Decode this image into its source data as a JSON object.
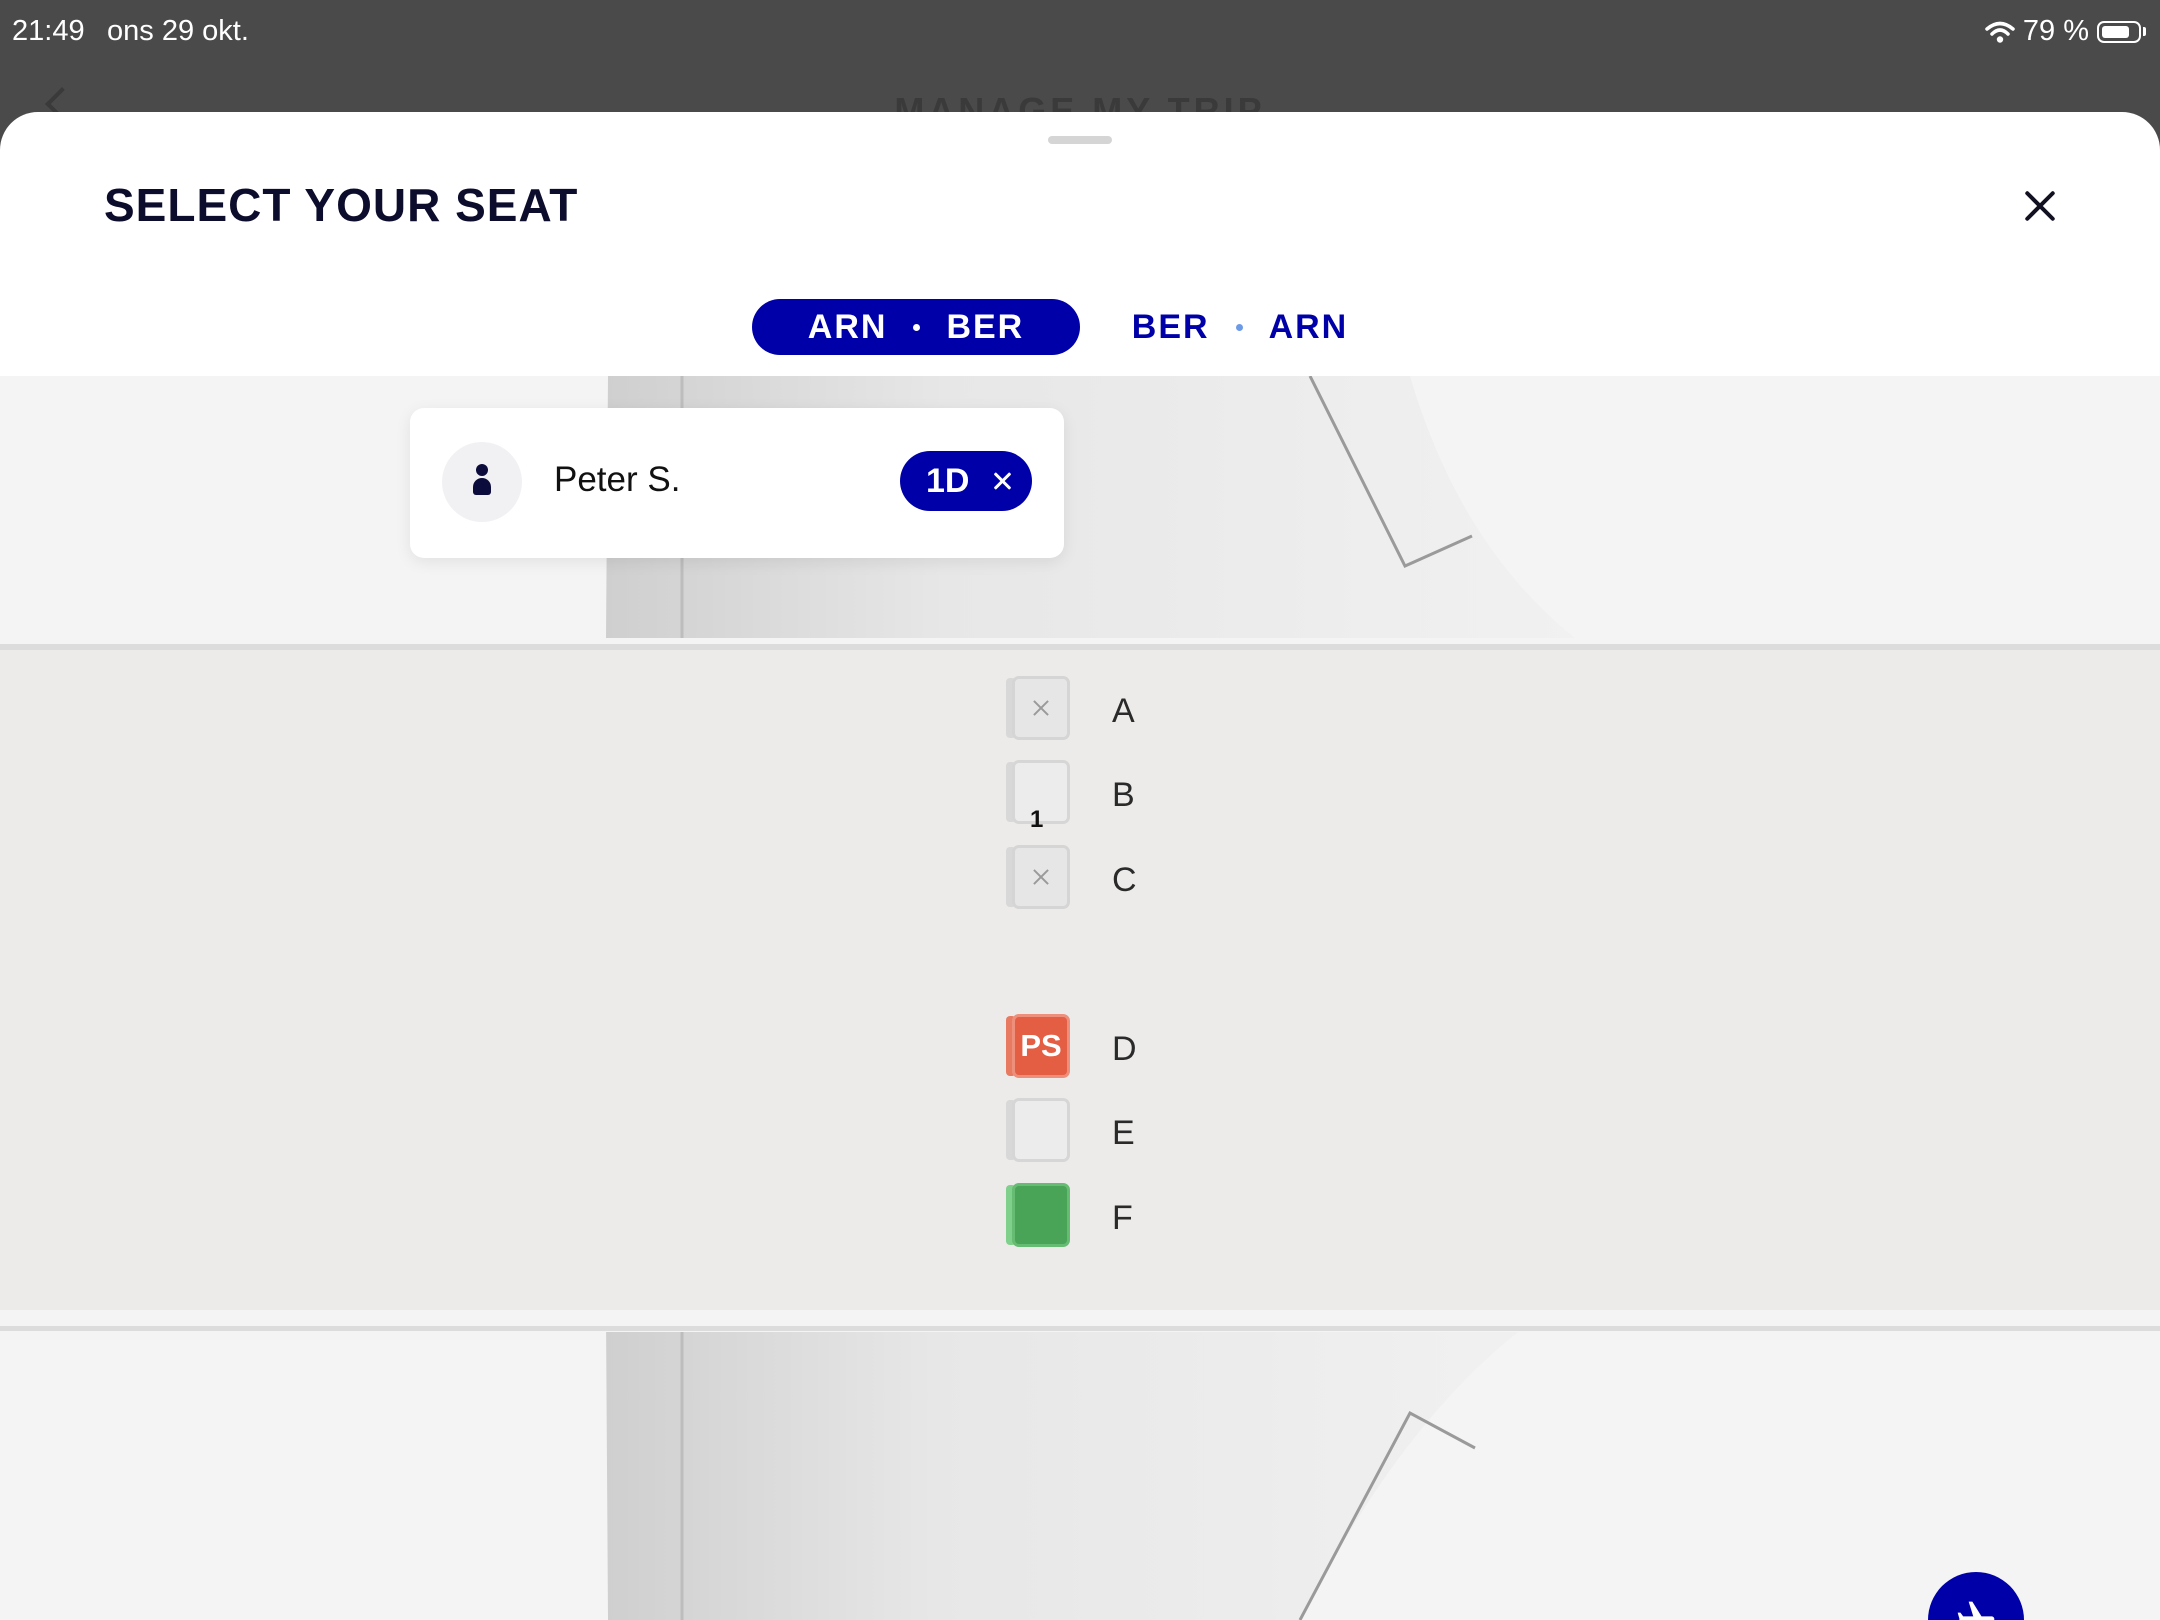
{
  "status_bar": {
    "time": "21:49",
    "date": "ons 29 okt.",
    "battery_text": "79 %",
    "battery_level": 0.79,
    "wifi_icon": "wifi-icon"
  },
  "background_page": {
    "title": "MANAGE MY TRIP"
  },
  "sheet": {
    "title": "SELECT YOUR SEAT",
    "close_icon": "close-icon"
  },
  "tabs": [
    {
      "from": "ARN",
      "to": "BER",
      "active": true
    },
    {
      "from": "BER",
      "to": "ARN",
      "active": false
    }
  ],
  "passenger": {
    "name": "Peter S.",
    "seat": "1D",
    "avatar_icon": "person-icon"
  },
  "seat_map": {
    "row_number": "1",
    "seats": [
      {
        "letter": "A",
        "status": "unavailable"
      },
      {
        "letter": "B",
        "status": "available"
      },
      {
        "letter": "C",
        "status": "unavailable"
      },
      {
        "letter": "D",
        "status": "selected",
        "label": "PS"
      },
      {
        "letter": "E",
        "status": "available"
      },
      {
        "letter": "F",
        "status": "available-special"
      }
    ]
  },
  "fab": {
    "icon": "airplane-icon"
  },
  "colors": {
    "primary": "#0000a8",
    "selected_seat": "#e45e44",
    "special_seat": "#49a457",
    "title_text": "#0c0c2c"
  }
}
